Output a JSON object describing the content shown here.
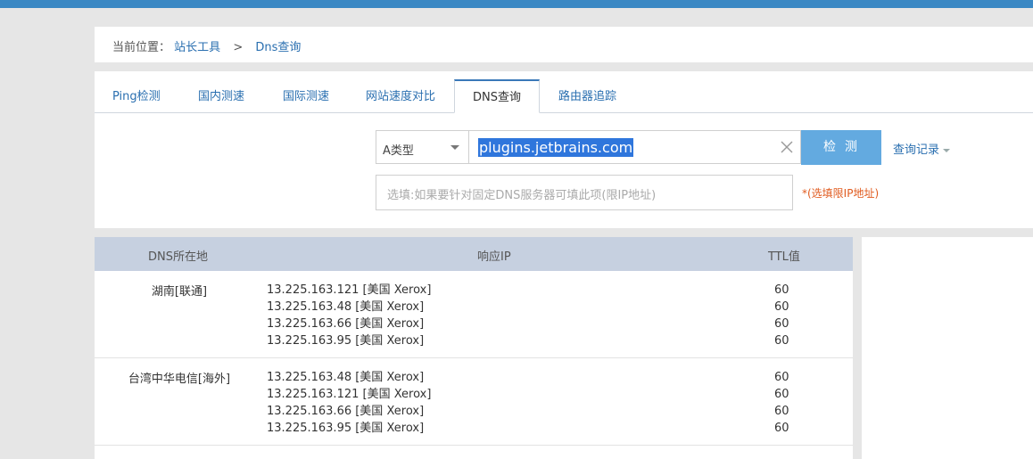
{
  "breadcrumb": {
    "label": "当前位置：",
    "link": "站长工具",
    "separator": ">",
    "current": "Dns查询"
  },
  "tabs": [
    {
      "label": "Ping检测",
      "active": false
    },
    {
      "label": "国内测速",
      "active": false
    },
    {
      "label": "国际测速",
      "active": false
    },
    {
      "label": "网站速度对比",
      "active": false
    },
    {
      "label": "DNS查询",
      "active": true
    },
    {
      "label": "路由器追踪",
      "active": false
    }
  ],
  "form": {
    "type_select": "A类型",
    "domain_value": "plugins.jetbrains.com",
    "check_button": "检测",
    "history_label": "查询记录",
    "server_placeholder": "选填:如果要针对固定DNS服务器可填此项(限IP地址)",
    "server_hint": "*(选填限IP地址)"
  },
  "table": {
    "headers": {
      "location": "DNS所在地",
      "ip": "响应IP",
      "ttl": "TTL值"
    },
    "rows": [
      {
        "location": "湖南[联通]",
        "ips": [
          "13.225.163.121 [美国 Xerox]",
          "13.225.163.48 [美国 Xerox]",
          "13.225.163.66 [美国 Xerox]",
          "13.225.163.95 [美国 Xerox]"
        ],
        "ttls": [
          "60",
          "60",
          "60",
          "60"
        ]
      },
      {
        "location": "台湾中华电信[海外]",
        "ips": [
          "13.225.163.48 [美国 Xerox]",
          "13.225.163.121 [美国 Xerox]",
          "13.225.163.66 [美国 Xerox]",
          "13.225.163.95 [美国 Xerox]"
        ],
        "ttls": [
          "60",
          "60",
          "60",
          "60"
        ]
      }
    ]
  },
  "colors": {
    "accent": "#3a88c4",
    "link": "#2a6fb0",
    "button": "#63aae0",
    "hint": "#e05a1e",
    "table_header": "#c6d0e0",
    "selection": "#2f76dc"
  }
}
